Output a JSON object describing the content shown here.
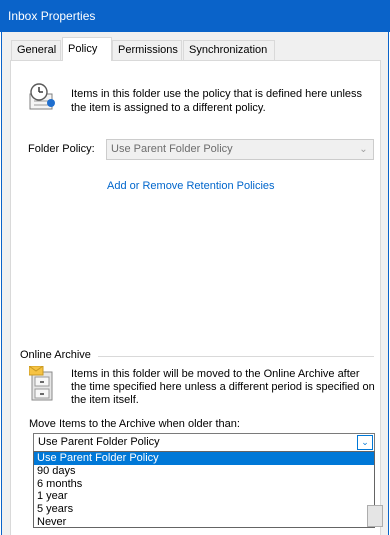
{
  "window": {
    "title": "Inbox Properties"
  },
  "tabs": [
    "General",
    "Policy",
    "Permissions",
    "Synchronization"
  ],
  "policy": {
    "info": "Items in this folder use the policy that is defined here unless the item is assigned to a different policy.",
    "folder_policy_label": "Folder Policy:",
    "folder_policy_value": "Use Parent Folder Policy",
    "retention_link": "Add or Remove Retention Policies"
  },
  "archive": {
    "section_title": "Online Archive",
    "info": "Items in this folder will be moved to the Online Archive after the time specified here unless a different period is specified on the item itself.",
    "move_label": "Move Items to the Archive when older than:",
    "selected_value": "Use Parent Folder Policy",
    "options": [
      "Use Parent Folder Policy",
      "90 days",
      "6 months",
      "1 year",
      "5 years",
      "Never"
    ]
  }
}
